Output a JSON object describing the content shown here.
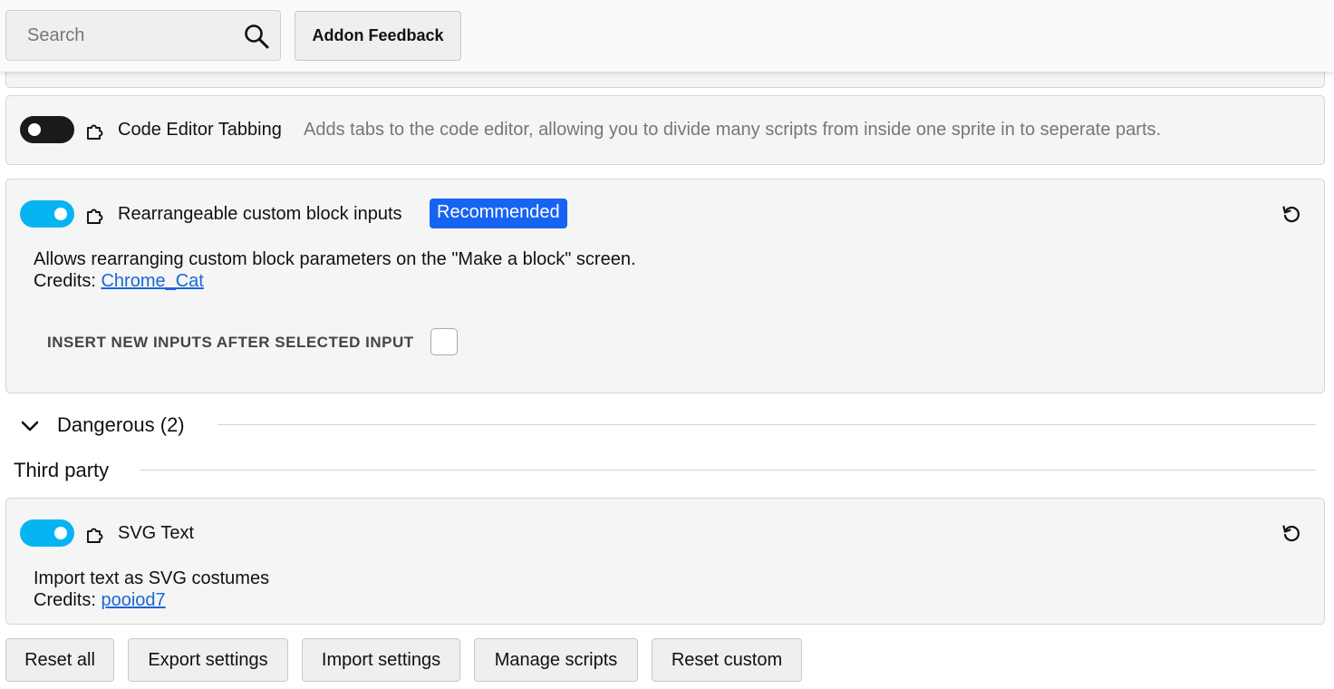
{
  "search": {
    "placeholder": "Search",
    "value": ""
  },
  "header": {
    "feedback_label": "Addon Feedback"
  },
  "addons": [
    {
      "title": "Code Editor Tabbing",
      "description": "Adds tabs to the code editor, allowing you to divide many scripts from inside one sprite in to seperate parts.",
      "enabled": false
    },
    {
      "title": "Rearrangeable custom block inputs",
      "badge": "Recommended",
      "description": "Allows rearranging custom block parameters on the \"Make a block\" screen.",
      "credits_label": "Credits:",
      "credits_author": "Chrome_Cat",
      "enabled": true,
      "setting_label": "INSERT NEW INPUTS AFTER SELECTED INPUT",
      "setting_checked": false
    },
    {
      "title": "SVG Text",
      "description": "Import text as SVG costumes",
      "credits_label": "Credits:",
      "credits_author": "pooiod7",
      "enabled": true
    }
  ],
  "sections": {
    "dangerous": "Dangerous (2)",
    "third_party": "Third party"
  },
  "footer": {
    "reset_all": "Reset all",
    "export": "Export settings",
    "import": "Import settings",
    "manage_scripts": "Manage scripts",
    "reset_custom": "Reset custom"
  },
  "colors": {
    "toggle_on": "#07b4f2",
    "toggle_off": "#1a1a1a",
    "badge": "#1764f3",
    "link": "#1a66d8"
  },
  "icons": {
    "search": "search-icon",
    "addon": "puzzle-icon",
    "reset": "reset-icon",
    "collapse": "chevron-down-icon"
  }
}
